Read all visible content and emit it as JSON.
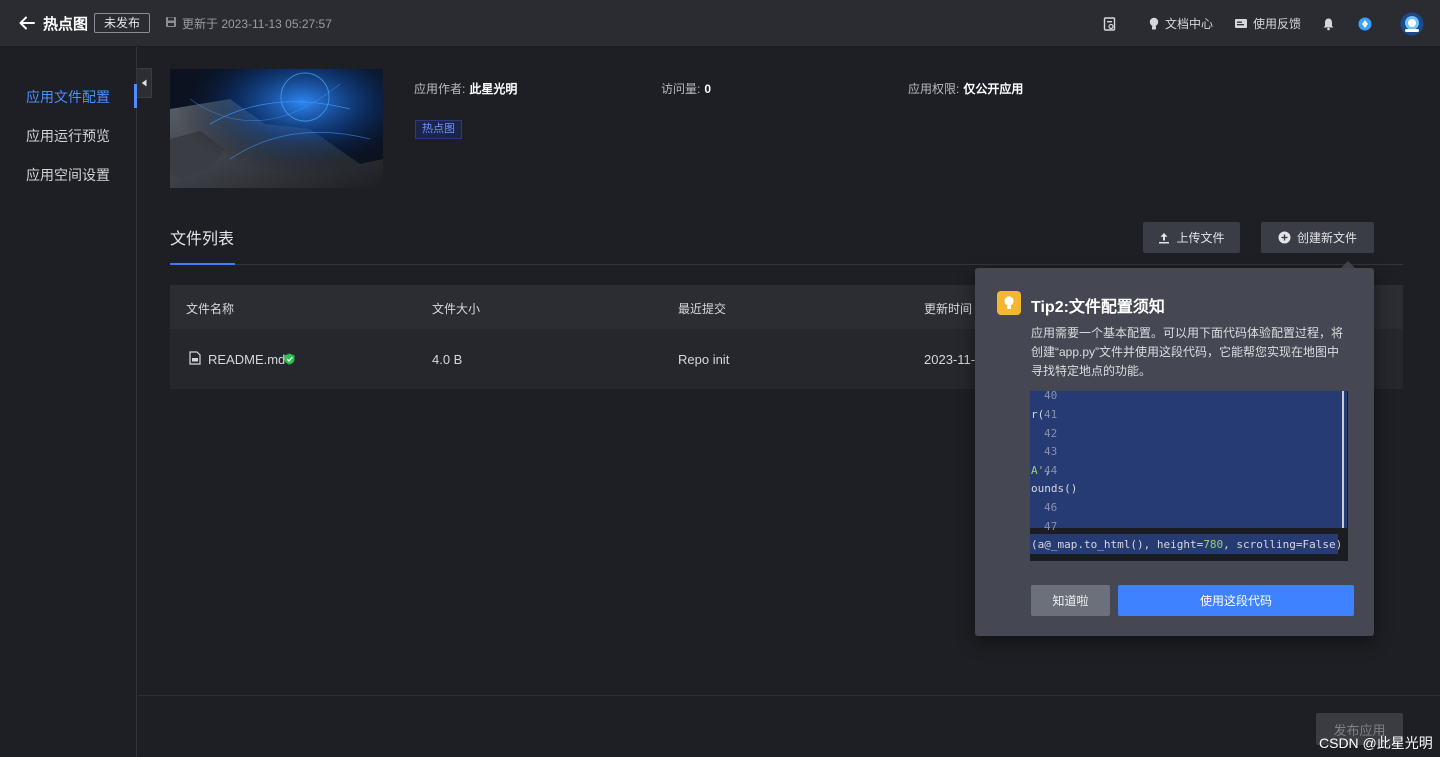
{
  "header": {
    "title": "热点图",
    "status": "未发布",
    "updated": "更新于 2023-11-13 05:27:57",
    "nav": {
      "docs": "文档中心",
      "feedback": "使用反馈"
    }
  },
  "sidebar": {
    "items": [
      {
        "label": "应用文件配置"
      },
      {
        "label": "应用运行预览"
      },
      {
        "label": "应用空间设置"
      }
    ]
  },
  "app_info": {
    "author_label": "应用作者:",
    "author": "此星光明",
    "visits_label": "访问量:",
    "visits": "0",
    "permission_label": "应用权限:",
    "permission": "仅公开应用",
    "tag": "热点图"
  },
  "files": {
    "title": "文件列表",
    "upload_label": "上传文件",
    "create_label": "创建新文件",
    "columns": [
      "文件名称",
      "文件大小",
      "最近提交",
      "更新时间"
    ],
    "rows": [
      {
        "name": "README.md",
        "size": "4.0 B",
        "commit": "Repo init",
        "updated": "2023-11-"
      }
    ]
  },
  "tip": {
    "title": "Tip2:文件配置须知",
    "desc": "应用需要一个基本配置。可以用下面代码体验配置过程，将创建“app.py”文件并使用这段代码，它能帮您实现在地图中寻找特定地点的功能。",
    "code": {
      "line_40": "40",
      "line_41_text": "r(",
      "line_41": "41",
      "line_42": "42",
      "line_43": "43",
      "line_44_text": "A',",
      "line_44": "44",
      "line_45_text": "ounds()",
      "line_46": "46",
      "line_47": "47",
      "last_prefix": "(a",
      "last_call": "@_map.to_html(), height=",
      "last_num": "780",
      "last_suffix": ", scrolling=False)"
    },
    "dismiss_label": "知道啦",
    "use_label": "使用这段代码"
  },
  "footer": {
    "publish_label": "发布应用",
    "watermark": "CSDN @此星光明"
  },
  "colors": {
    "accent": "#3e82ff",
    "tip_icon": "#f5b731",
    "verified": "#27c24c"
  }
}
